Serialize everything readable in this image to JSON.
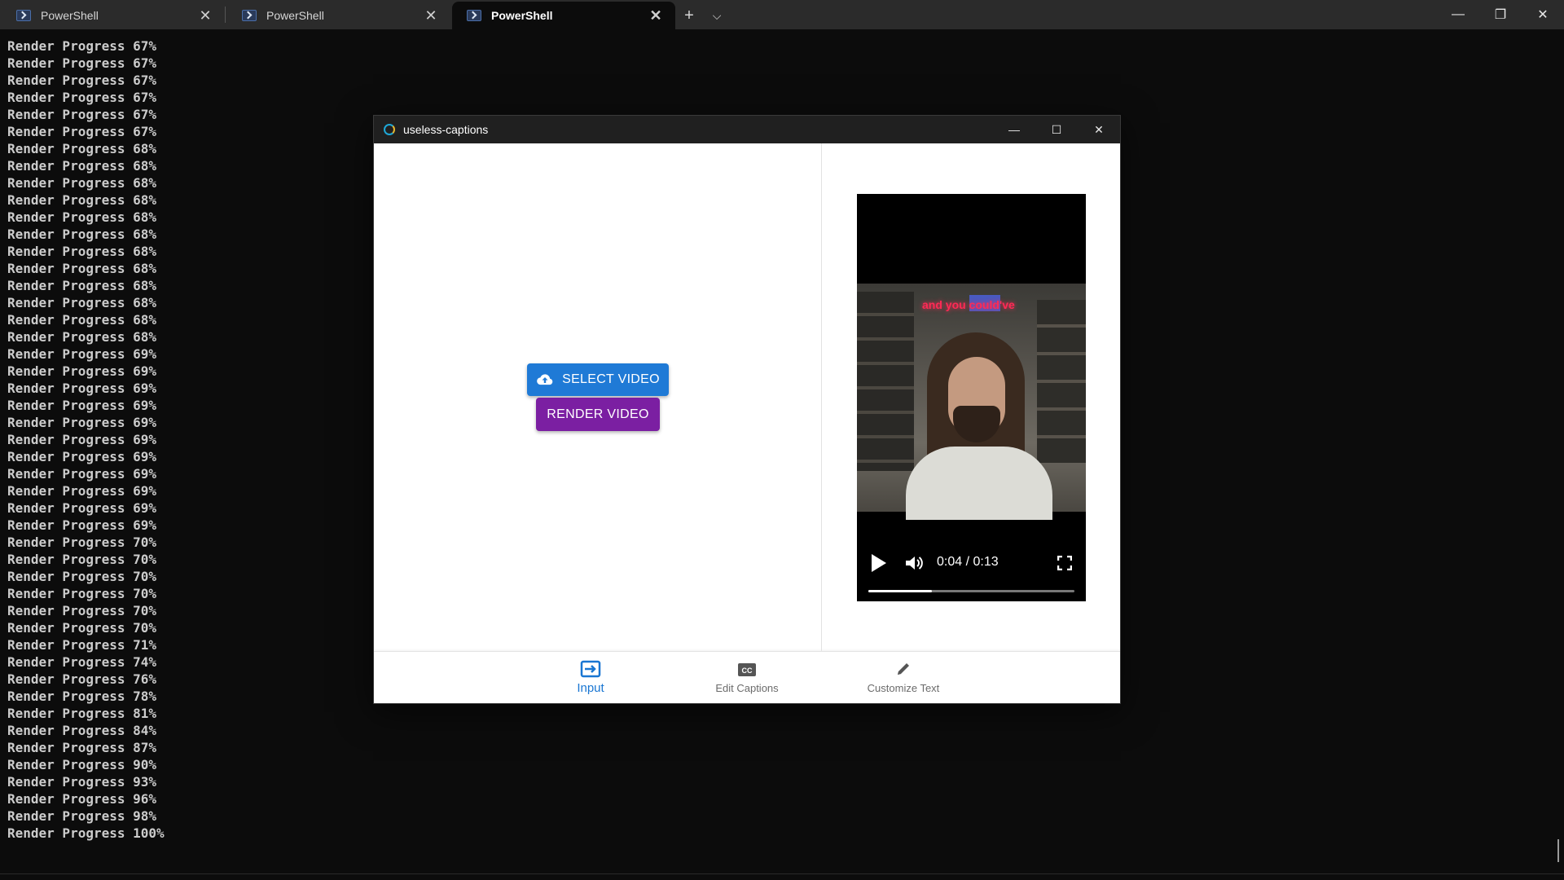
{
  "terminal": {
    "tabs": [
      {
        "label": "PowerShell",
        "active": false
      },
      {
        "label": "PowerShell",
        "active": false
      },
      {
        "label": "PowerShell",
        "active": true
      }
    ],
    "output_lines": [
      "Render Progress 67%",
      "Render Progress 67%",
      "Render Progress 67%",
      "Render Progress 67%",
      "Render Progress 67%",
      "Render Progress 67%",
      "Render Progress 68%",
      "Render Progress 68%",
      "Render Progress 68%",
      "Render Progress 68%",
      "Render Progress 68%",
      "Render Progress 68%",
      "Render Progress 68%",
      "Render Progress 68%",
      "Render Progress 68%",
      "Render Progress 68%",
      "Render Progress 68%",
      "Render Progress 68%",
      "Render Progress 69%",
      "Render Progress 69%",
      "Render Progress 69%",
      "Render Progress 69%",
      "Render Progress 69%",
      "Render Progress 69%",
      "Render Progress 69%",
      "Render Progress 69%",
      "Render Progress 69%",
      "Render Progress 69%",
      "Render Progress 69%",
      "Render Progress 70%",
      "Render Progress 70%",
      "Render Progress 70%",
      "Render Progress 70%",
      "Render Progress 70%",
      "Render Progress 70%",
      "Render Progress 71%",
      "Render Progress 74%",
      "Render Progress 76%",
      "Render Progress 78%",
      "Render Progress 81%",
      "Render Progress 84%",
      "Render Progress 87%",
      "Render Progress 90%",
      "Render Progress 93%",
      "Render Progress 96%",
      "Render Progress 98%",
      "Render Progress 100%"
    ]
  },
  "app": {
    "title": "useless-captions",
    "select_button": "SELECT VIDEO",
    "render_button": "RENDER VIDEO",
    "video": {
      "time": "0:04 / 0:13",
      "progress": 0.31,
      "caption_overlay": "and you could've"
    },
    "nav": [
      {
        "label": "Input",
        "icon": "input-icon",
        "active": true
      },
      {
        "label": "Edit Captions",
        "icon": "closed-captions-icon",
        "active": false
      },
      {
        "label": "Customize Text",
        "icon": "pencil-icon",
        "active": false
      }
    ]
  },
  "colors": {
    "select_button": "#1f7ad6",
    "render_button": "#7b1fa2",
    "nav_active": "#1976d2"
  }
}
